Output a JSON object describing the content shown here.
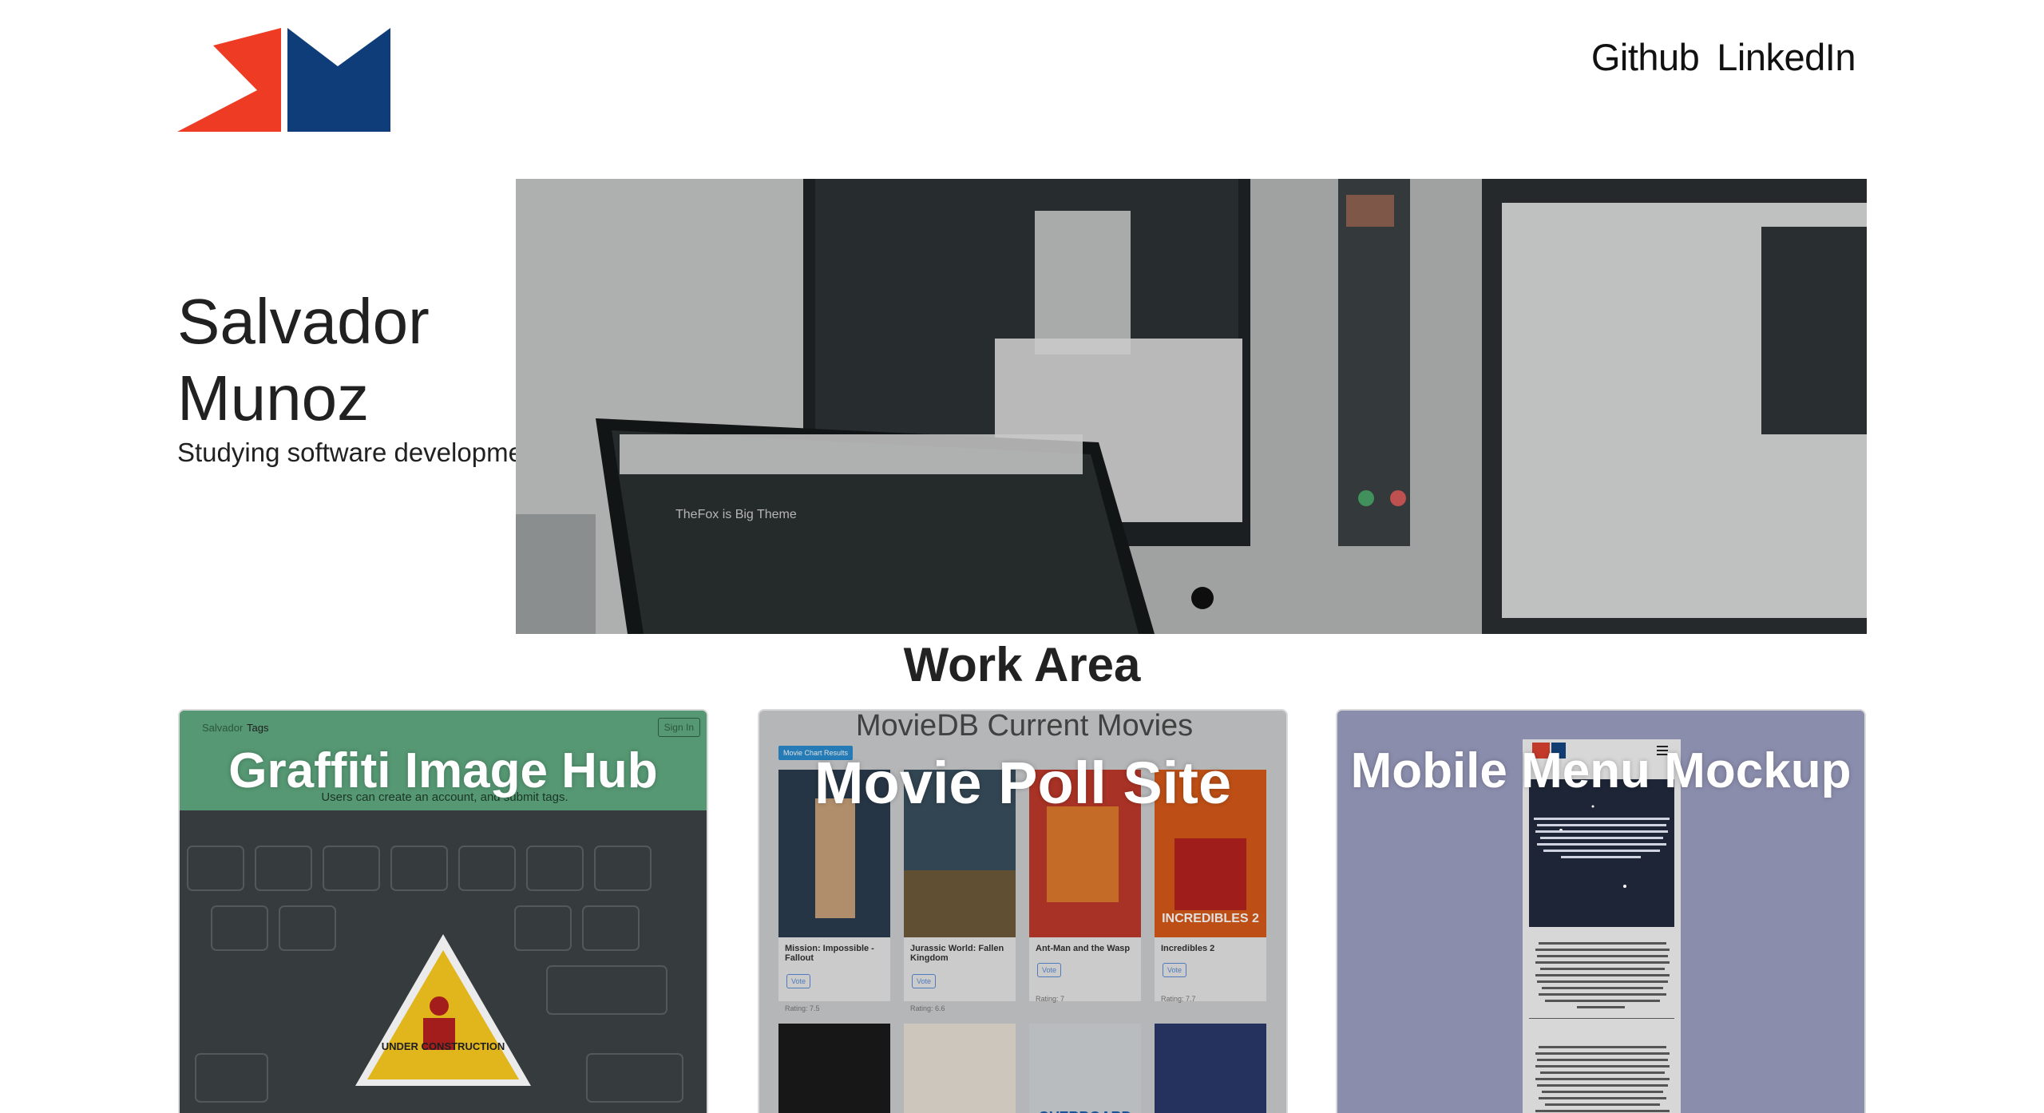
{
  "header": {
    "logo_alt": "SM logo",
    "nav": [
      "Github",
      "LinkedIn"
    ]
  },
  "hero": {
    "name": "Salvador Munoz",
    "subtitle": "Studying software development"
  },
  "work": {
    "title": "Work Area",
    "cards": [
      {
        "title": "Graffiti Image Hub",
        "mock_nav_left": "Salvador",
        "mock_nav_tags": "Tags",
        "mock_signin": "Sign In",
        "mock_tagline": "Users can create an account, and submit tags."
      },
      {
        "title": "Movie Poll Site",
        "mock_heading": "MovieDB Current Movies",
        "mock_button": "Movie Chart Results",
        "movies": [
          {
            "name": "Mission: Impossible - Fallout",
            "rating": "Rating: 7.5"
          },
          {
            "name": "Jurassic World: Fallen Kingdom",
            "rating": "Rating: 6.6"
          },
          {
            "name": "Ant-Man and the Wasp",
            "rating": "Rating: 7"
          },
          {
            "name": "Incredibles 2",
            "rating": "Rating: 7.7"
          }
        ],
        "vote_label": "Vote"
      },
      {
        "title": "Mobile Menu Mockup"
      }
    ]
  },
  "colors": {
    "logo_red": "#ee3b24",
    "logo_blue": "#0f3d79",
    "card1_green": "#5ea57d",
    "card3_purple": "#8b8dad"
  }
}
